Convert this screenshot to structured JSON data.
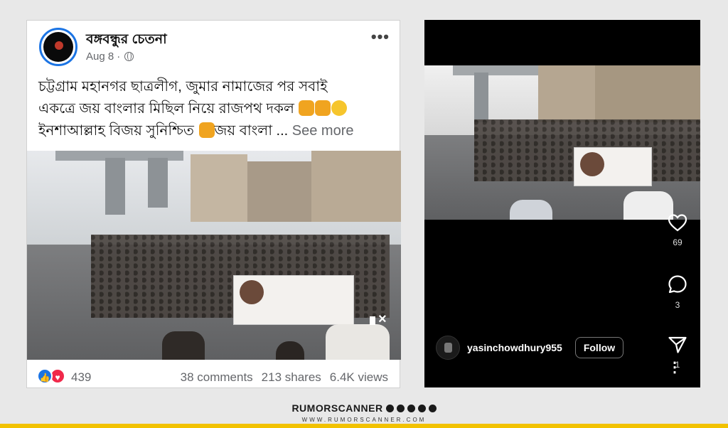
{
  "facebook_post": {
    "page_name": "বঙ্গবন্ধুর চেতনা",
    "date": "Aug 8",
    "date_separator": "·",
    "text_line1": "চট্টগ্রাম মহানগর ছাত্রলীগ, জুমার নামাজের পর সবাই",
    "text_line2": "একত্রে জয় বাংলার মিছিল নিয়ে রাজপথ দকল",
    "text_line3_a": "ইনশাআল্লাহ বিজয় সুনিশ্চিত",
    "text_line3_b": "জয় বাংলা ...",
    "see_more": "See more",
    "more_menu": "•••",
    "reaction_count": "439",
    "comments": "38 comments",
    "shares": "213 shares",
    "views": "6.4K views",
    "icons": {
      "globe": "globe-icon",
      "like": "like-reaction-icon",
      "love": "love-reaction-icon",
      "mute": "muted-speaker-icon"
    }
  },
  "instagram_reel": {
    "likes": "69",
    "comments": "3",
    "shares": "1",
    "username": "yasinchowdhury955",
    "follow_label": "Follow",
    "kebab": "⋮",
    "icons": {
      "like": "heart-icon",
      "comment": "comment-bubble-icon",
      "share": "send-icon",
      "more": "more-vertical-icon"
    }
  },
  "branding": {
    "name": "RUMORSCANNER",
    "url": "WWW.RUMORSCANNER.COM",
    "accent_color": "#f2c200"
  },
  "colors": {
    "facebook_blue": "#1b74e4",
    "love_red": "#f0284a",
    "background": "#e8e8e8"
  }
}
